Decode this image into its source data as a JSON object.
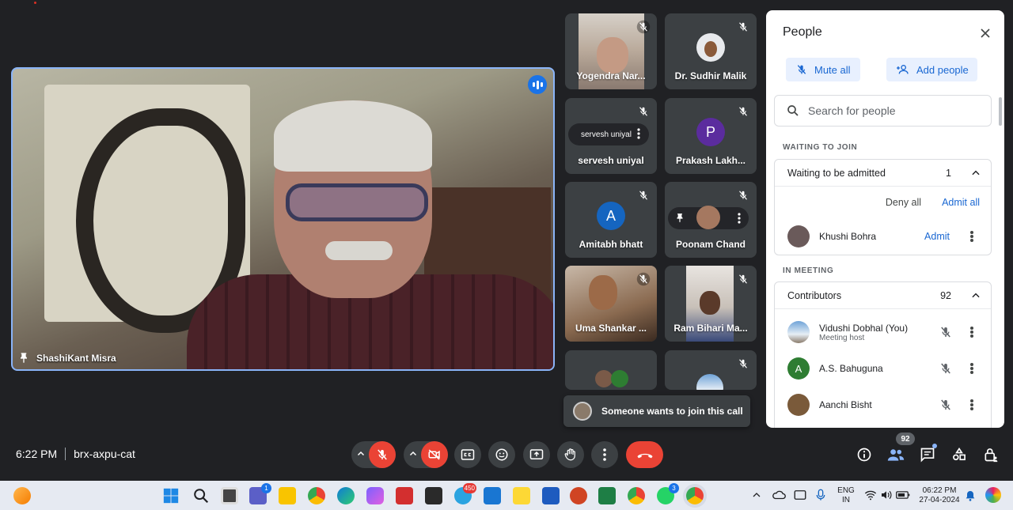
{
  "main_video": {
    "name": "ShashiKant Misra"
  },
  "tiles": [
    {
      "name": "Yogendra Nar...",
      "type": "video"
    },
    {
      "name": "Dr. Sudhir Malik",
      "type": "photo-avatar"
    },
    {
      "name": "servesh uniyal",
      "type": "avatar",
      "hover_label": "servesh uniyal"
    },
    {
      "name": "Prakash Lakh...",
      "type": "avatar",
      "initial": "P",
      "color": "#5b2c9e"
    },
    {
      "name": "Amitabh bhatt",
      "type": "avatar",
      "initial": "A",
      "color": "#1565c0"
    },
    {
      "name": "Poonam Chand",
      "type": "photo-avatar"
    },
    {
      "name": "Uma Shankar ...",
      "type": "video"
    },
    {
      "name": "Ram Bihari Ma...",
      "type": "video"
    },
    {
      "name": "",
      "type": "group"
    },
    {
      "name": "",
      "type": "photo-avatar"
    }
  ],
  "toast": {
    "text": "Someone wants to join this call"
  },
  "people_panel": {
    "title": "People",
    "mute_all": "Mute all",
    "add_people": "Add people",
    "search_placeholder": "Search for people",
    "waiting_label": "WAITING TO JOIN",
    "waiting_group": {
      "title": "Waiting to be admitted",
      "count": "1"
    },
    "deny_all": "Deny all",
    "admit_all": "Admit all",
    "waiting_person": {
      "name": "Khushi Bohra",
      "action": "Admit"
    },
    "in_meeting_label": "IN MEETING",
    "contributors": {
      "title": "Contributors",
      "count": "92"
    },
    "members": [
      {
        "name": "Vidushi Dobhal (You)",
        "sub": "Meeting host"
      },
      {
        "name": "A.S. Bahuguna",
        "sub": "",
        "initial": "A",
        "color": "#2e7d32"
      },
      {
        "name": "Aanchi Bisht",
        "sub": ""
      }
    ]
  },
  "bottom_bar": {
    "time": "6:22 PM",
    "meeting_code": "brx-axpu-cat",
    "people_count": "92"
  },
  "taskbar": {
    "teams_badge": "1",
    "telegram_badge": "450",
    "whatsapp_badge": "3",
    "lang_top": "ENG",
    "lang_bottom": "IN",
    "clock_time": "06:22 PM",
    "clock_date": "27-04-2024"
  },
  "colors": {
    "accent": "#1a73e8",
    "danger": "#ea4335",
    "bg": "#202124",
    "tile": "#3c4043"
  }
}
